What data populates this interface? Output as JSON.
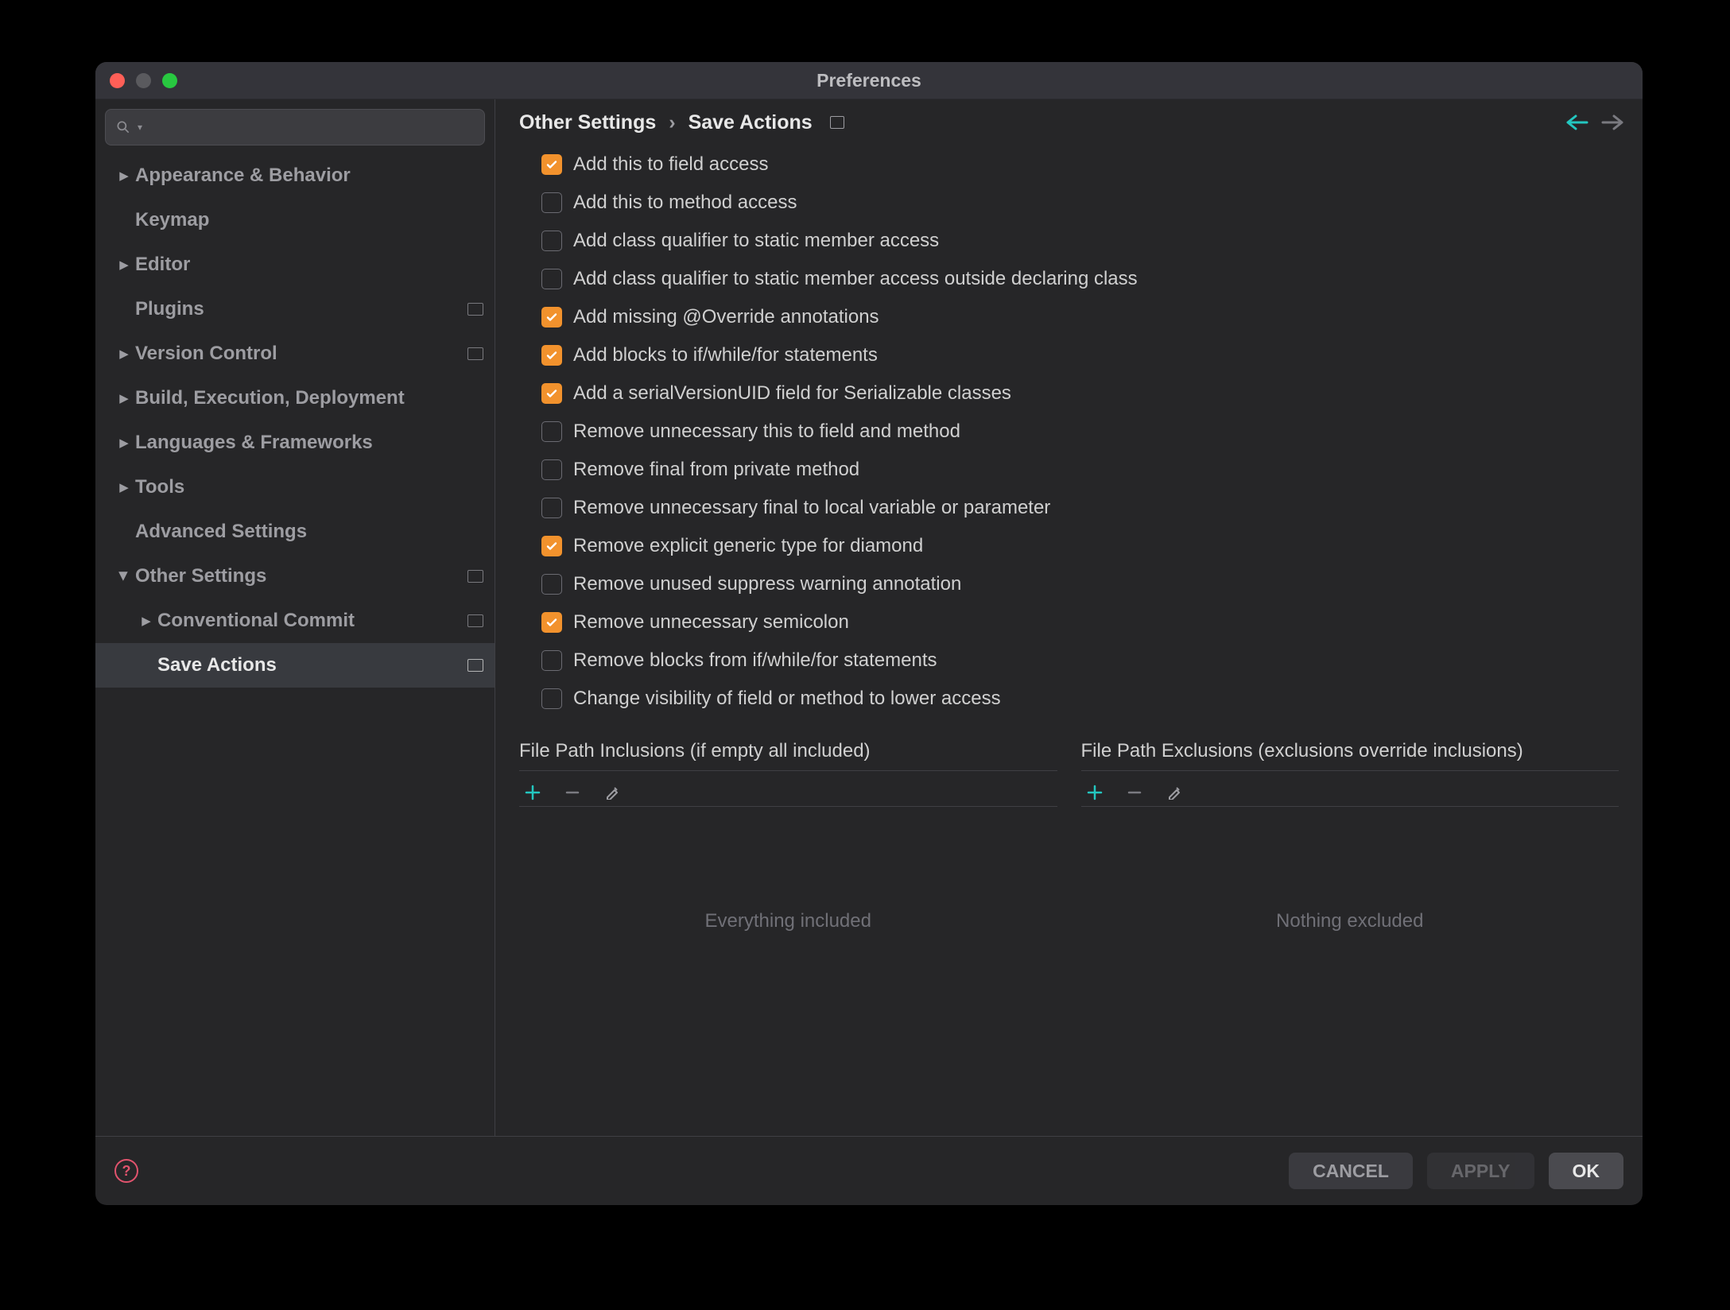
{
  "window": {
    "title": "Preferences"
  },
  "sidebar": {
    "search_placeholder": "",
    "items": [
      {
        "label": "Appearance & Behavior",
        "expandable": true,
        "expanded": false,
        "level": 0,
        "selected": false,
        "save": false
      },
      {
        "label": "Keymap",
        "expandable": false,
        "level": 0,
        "selected": false,
        "save": false
      },
      {
        "label": "Editor",
        "expandable": true,
        "expanded": false,
        "level": 0,
        "selected": false,
        "save": false
      },
      {
        "label": "Plugins",
        "expandable": false,
        "level": 0,
        "selected": false,
        "save": true
      },
      {
        "label": "Version Control",
        "expandable": true,
        "expanded": false,
        "level": 0,
        "selected": false,
        "save": true
      },
      {
        "label": "Build, Execution, Deployment",
        "expandable": true,
        "expanded": false,
        "level": 0,
        "selected": false,
        "save": false
      },
      {
        "label": "Languages & Frameworks",
        "expandable": true,
        "expanded": false,
        "level": 0,
        "selected": false,
        "save": false
      },
      {
        "label": "Tools",
        "expandable": true,
        "expanded": false,
        "level": 0,
        "selected": false,
        "save": false
      },
      {
        "label": "Advanced Settings",
        "expandable": false,
        "level": 0,
        "selected": false,
        "save": false
      },
      {
        "label": "Other Settings",
        "expandable": true,
        "expanded": true,
        "level": 0,
        "selected": false,
        "save": true
      },
      {
        "label": "Conventional Commit",
        "expandable": true,
        "expanded": false,
        "level": 1,
        "selected": false,
        "save": true
      },
      {
        "label": "Save Actions",
        "expandable": false,
        "level": 1,
        "selected": true,
        "save": true
      }
    ]
  },
  "breadcrumb": {
    "root": "Other Settings",
    "leaf": "Save Actions"
  },
  "options": [
    {
      "label": "Add this to field access",
      "checked": true
    },
    {
      "label": "Add this to method access",
      "checked": false
    },
    {
      "label": "Add class qualifier to static member access",
      "checked": false
    },
    {
      "label": "Add class qualifier to static member access outside declaring class",
      "checked": false
    },
    {
      "label": "Add missing @Override annotations",
      "checked": true
    },
    {
      "label": "Add blocks to if/while/for statements",
      "checked": true
    },
    {
      "label": "Add a serialVersionUID field for Serializable classes",
      "checked": true
    },
    {
      "label": "Remove unnecessary this to field and method",
      "checked": false
    },
    {
      "label": "Remove final from private method",
      "checked": false
    },
    {
      "label": "Remove unnecessary final to local variable or parameter",
      "checked": false
    },
    {
      "label": "Remove explicit generic type for diamond",
      "checked": true
    },
    {
      "label": "Remove unused suppress warning annotation",
      "checked": false
    },
    {
      "label": "Remove unnecessary semicolon",
      "checked": true
    },
    {
      "label": "Remove blocks from if/while/for statements",
      "checked": false
    },
    {
      "label": "Change visibility of field or method to lower access",
      "checked": false
    }
  ],
  "paths": {
    "inclusions_title": "File Path Inclusions (if empty all included)",
    "inclusions_placeholder": "Everything included",
    "exclusions_title": "File Path Exclusions (exclusions override inclusions)",
    "exclusions_placeholder": "Nothing excluded"
  },
  "footer": {
    "cancel": "CANCEL",
    "apply": "APPLY",
    "ok": "OK"
  },
  "colors": {
    "accent": "#f2922d",
    "teal": "#23c7c0"
  }
}
